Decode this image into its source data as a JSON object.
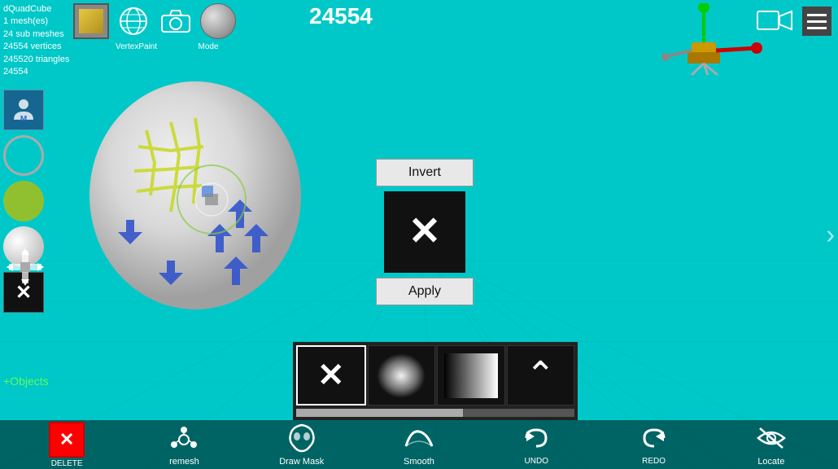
{
  "app": {
    "title": "dQuadCube",
    "mesh_count": "1 mesh(es)",
    "sub_meshes": "24 sub meshes",
    "vertices": "24554 vertices",
    "triangles": "245520 triangles",
    "count_label": "24554",
    "vertex_count_display": "24554"
  },
  "top_icons": {
    "vertex_paint_label": "VertexPaint",
    "mode_label": "Mode"
  },
  "popup": {
    "invert_label": "Invert",
    "apply_label": "Apply"
  },
  "bottom_toolbar": {
    "brushes": [
      {
        "id": "x-brush",
        "symbol": "✕"
      },
      {
        "id": "cloud-brush",
        "symbol": "cloud"
      },
      {
        "id": "gradient-brush",
        "symbol": "gradient"
      },
      {
        "id": "up-arrow-brush",
        "symbol": "▲"
      }
    ]
  },
  "nav": {
    "items": [
      {
        "id": "delete",
        "label": "DELETE",
        "icon": "✕"
      },
      {
        "id": "remesh",
        "label": "remesh",
        "icon": "👁"
      },
      {
        "id": "draw-mask",
        "label": "Draw Mask",
        "icon": "🎭"
      },
      {
        "id": "smooth",
        "label": "Smooth",
        "icon": "~"
      },
      {
        "id": "undo",
        "label": "UNDO",
        "icon": "↩"
      },
      {
        "id": "redo",
        "label": "REDO",
        "icon": "↪"
      },
      {
        "id": "locate",
        "label": "Locate",
        "icon": "⊙"
      }
    ]
  },
  "objects_btn": "+Objects",
  "colors": {
    "bg": "#00bfbf",
    "toolbar_bg": "rgba(0,0,0,0.5)",
    "popup_btn_bg": "#e8e8e8"
  }
}
